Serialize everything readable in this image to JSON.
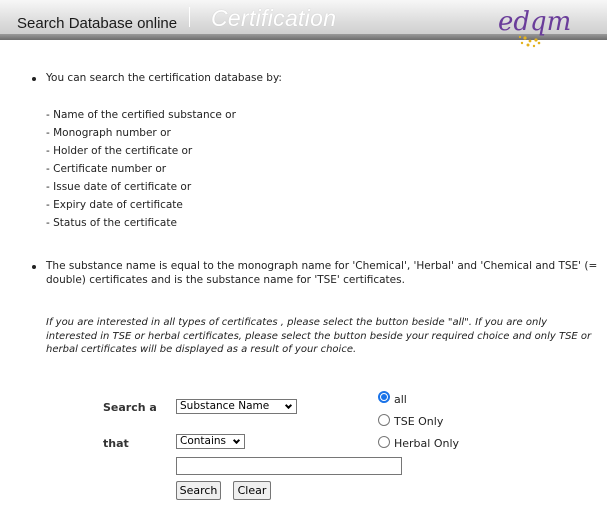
{
  "header": {
    "title": "Search Database online",
    "section": "Certification",
    "logo_text": "edqm"
  },
  "intro": {
    "lead": "You can search the certification database by:",
    "criteria": [
      "- Name of the certified substance or",
      "- Monograph number or",
      "- Holder of the certificate or",
      "- Certificate number or",
      "- Issue date of certificate or",
      "- Expiry date of certificate",
      "- Status of the certificate"
    ]
  },
  "note": {
    "line1": "The substance name is equal to the monograph name for 'Chemical', 'Herbal' and 'Chemical and TSE' (=",
    "line2": "double) certificates and is the substance name for 'TSE' certificates."
  },
  "instructions": "If you are interested in all types of certificates , please select the button beside \"all\". If you are only interested in TSE or herbal certificates, please select the button beside your required choice and only TSE or herbal certificates will be displayed as a result of your choice.",
  "form": {
    "search_label": "Search a",
    "field_select": "Substance Name",
    "that_label": "that",
    "operator_select": "Contains",
    "query_value": "",
    "search_button": "Search",
    "clear_button": "Clear",
    "filters": [
      {
        "label": "all",
        "checked": true
      },
      {
        "label": "TSE Only",
        "checked": false
      },
      {
        "label": "Herbal Only",
        "checked": false
      }
    ]
  },
  "colors": {
    "accent": "#1a73e8",
    "logo_purple": "#6a3d9a",
    "logo_gold": "#e3b21b"
  }
}
